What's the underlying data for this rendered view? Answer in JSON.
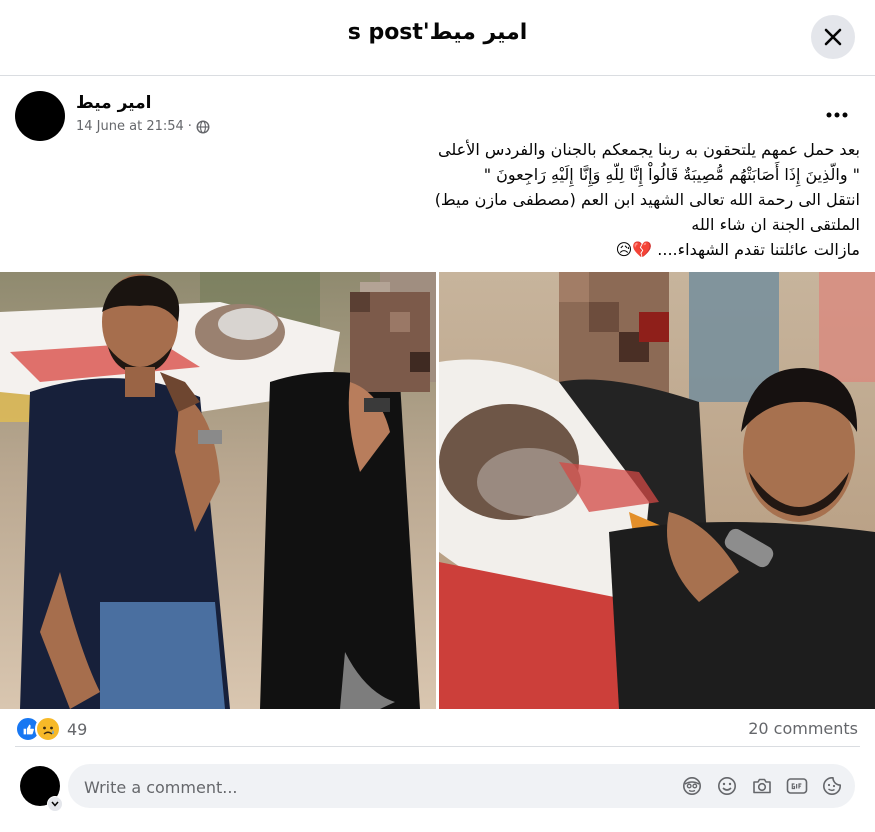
{
  "header": {
    "title": "امير ميط's post"
  },
  "post": {
    "author": "امير ميط",
    "timestamp": "14 June at 21:54",
    "separator": "·",
    "audience_icon": "globe-icon",
    "lines": [
      "بعد حمل عمهم يلتحقون به ربنا يجمعكم بالجنان والفردس الأعلى",
      "\" والّذِينَ إِذَا أَصَابَتْهُم مُّصِيبَةٌ قَالُواْ إِنَّا لِلّهِ وَإِنَّا إِلَيْهِ رَاجِعونَ \"",
      "انتقل الى رحمة الله تعالى الشهيد  ابن العم (مصطفى مازن ميط)",
      "الملتقى الجنة ان شاء الله",
      "مازالت عائلتنا تقدم الشهداء.... 💔😥"
    ]
  },
  "reactions": {
    "count": "49",
    "icons": [
      "like-icon",
      "sad-icon"
    ]
  },
  "comments": {
    "count_label": "20 comments"
  },
  "composer": {
    "placeholder": "Write a comment..."
  },
  "colors": {
    "like_blue": "#1877f2",
    "sad_yellow": "#f7b928",
    "text_secondary": "#65676b",
    "composer_bg": "#f0f2f5"
  }
}
